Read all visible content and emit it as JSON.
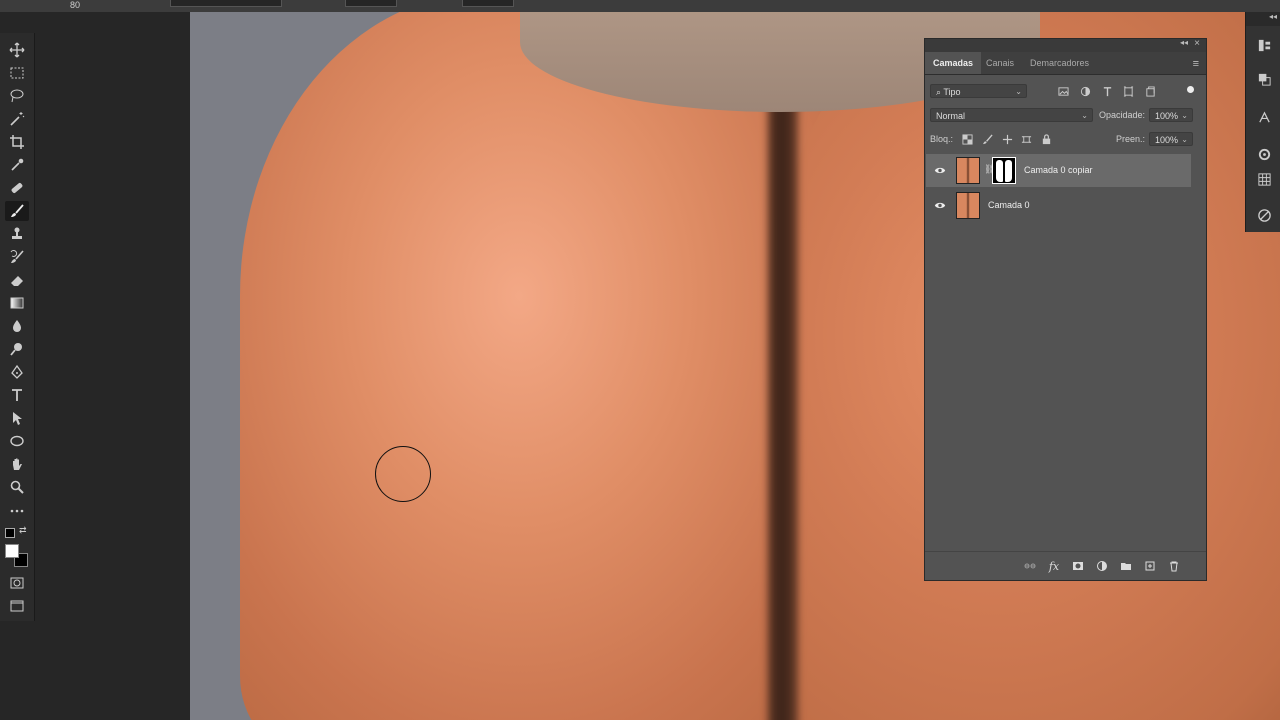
{
  "options_bar": {
    "brush_size": "80"
  },
  "tools": [
    {
      "name": "move-tool",
      "icon": "move-icon"
    },
    {
      "name": "marquee-tool",
      "icon": "rect-marquee-icon"
    },
    {
      "name": "lasso-tool",
      "icon": "lasso-icon"
    },
    {
      "name": "magic-wand-tool",
      "icon": "magic-wand-icon"
    },
    {
      "name": "crop-tool",
      "icon": "crop-icon"
    },
    {
      "name": "eyedropper-tool",
      "icon": "eyedropper-icon"
    },
    {
      "name": "healing-brush-tool",
      "icon": "bandage-icon"
    },
    {
      "name": "brush-tool",
      "icon": "brush-icon",
      "active": true
    },
    {
      "name": "clone-stamp-tool",
      "icon": "stamp-icon"
    },
    {
      "name": "history-brush-tool",
      "icon": "history-brush-icon"
    },
    {
      "name": "eraser-tool",
      "icon": "eraser-icon"
    },
    {
      "name": "gradient-tool",
      "icon": "gradient-icon"
    },
    {
      "name": "blur-tool",
      "icon": "drop-icon"
    },
    {
      "name": "dodge-tool",
      "icon": "dodge-icon"
    },
    {
      "name": "pen-tool",
      "icon": "pen-icon"
    },
    {
      "name": "type-tool",
      "icon": "type-icon"
    },
    {
      "name": "path-selection-tool",
      "icon": "arrow-icon"
    },
    {
      "name": "ellipse-tool",
      "icon": "ellipse-icon"
    },
    {
      "name": "hand-tool",
      "icon": "hand-icon"
    },
    {
      "name": "zoom-tool",
      "icon": "zoom-icon"
    },
    {
      "name": "more-tools",
      "icon": "ellipsis-icon"
    }
  ],
  "colors": {
    "foreground": "#ffffff",
    "background": "#000000",
    "panel_bg": "#535353",
    "selected_layer_bg": "#6a6a6a"
  },
  "layers_panel": {
    "tabs": [
      {
        "label": "Camadas",
        "active": true
      },
      {
        "label": "Canais",
        "active": false
      },
      {
        "label": "Demarcadores",
        "active": false
      }
    ],
    "filter": {
      "label": "Tipo"
    },
    "blend_mode": "Normal",
    "opacity_label": "Opacidade:",
    "opacity_value": "100%",
    "lock_label": "Bloq.:",
    "fill_label": "Preen.:",
    "fill_value": "100%",
    "layers": [
      {
        "name": "Camada 0 copiar",
        "visible": true,
        "has_mask": true,
        "selected": true
      },
      {
        "name": "Camada 0",
        "visible": true,
        "has_mask": false,
        "selected": false
      }
    ]
  }
}
